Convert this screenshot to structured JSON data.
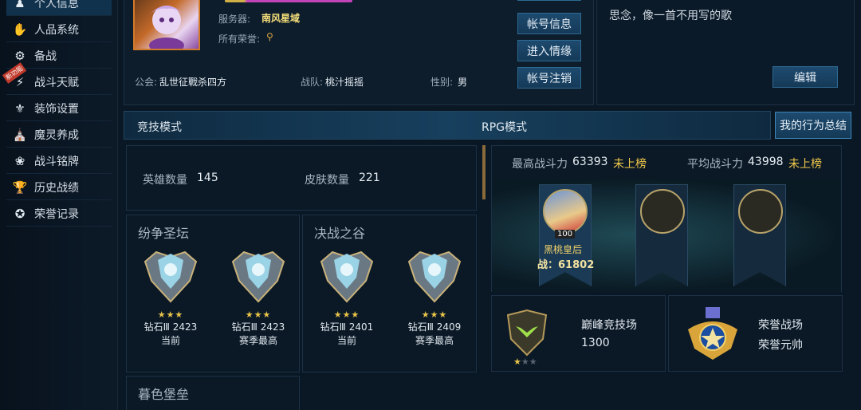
{
  "sidebar": {
    "items": [
      {
        "label": "个人信息",
        "icon": "person-icon"
      },
      {
        "label": "人品系统",
        "icon": "hand-icon"
      },
      {
        "label": "备战",
        "icon": "globe-icon"
      },
      {
        "label": "战斗天赋",
        "icon": "lightning-icon",
        "tag": "新功能"
      },
      {
        "label": "装饰设置",
        "icon": "trophy-icon"
      },
      {
        "label": "魔灵养成",
        "icon": "building-icon"
      },
      {
        "label": "战斗铭牌",
        "icon": "emblem-icon"
      },
      {
        "label": "历史战绩",
        "icon": "cup-icon"
      },
      {
        "label": "荣誉记录",
        "icon": "medal-icon"
      }
    ]
  },
  "profile": {
    "server_label": "服务器:",
    "server_value": "南风星域",
    "honor_label": "所有荣誉:",
    "guild_label": "公会:",
    "guild_value": "乱世征戰杀四方",
    "team_label": "战队:",
    "team_value": "桃汁摇摇",
    "gender_label": "性别:",
    "gender_value": "男"
  },
  "actions": {
    "account_info": "帐号信息",
    "enter_mood": "进入情缘",
    "account_cancel": "帐号注销"
  },
  "signature": {
    "text": "思念，像一首不用写的歌",
    "edit_label": "编辑"
  },
  "tabs": {
    "competitive": "竞技模式",
    "rpg": "RPG模式",
    "behavior_summary": "我的行为总结"
  },
  "counts": {
    "hero_label": "英雄数量",
    "hero_value": "145",
    "skin_label": "皮肤数量",
    "skin_value": "221"
  },
  "arenas": [
    {
      "title": "纷争圣坛",
      "ranks": [
        {
          "tier": "钻石Ⅲ",
          "score": "2423",
          "note": "当前"
        },
        {
          "tier": "钻石Ⅲ",
          "score": "2423",
          "note": "赛季最高"
        }
      ]
    },
    {
      "title": "决战之谷",
      "ranks": [
        {
          "tier": "钻石Ⅲ",
          "score": "2401",
          "note": "当前"
        },
        {
          "tier": "钻石Ⅲ",
          "score": "2409",
          "note": "赛季最高"
        }
      ]
    }
  ],
  "dusk": {
    "title": "暮色堡垒"
  },
  "power": {
    "max_label": "最高战斗力",
    "max_value": "63393",
    "max_rank": "未上榜",
    "avg_label": "平均战斗力",
    "avg_value": "43998",
    "avg_rank": "未上榜"
  },
  "top_hero": {
    "name": "黑桃皇后",
    "level": "100",
    "power_label": "战：",
    "power_value": "61802"
  },
  "peak": {
    "title": "巅峰竞技场",
    "score": "1300",
    "stars_filled": 1,
    "stars_total": 3
  },
  "honor": {
    "title": "荣誉战场",
    "rank": "荣誉元帅"
  },
  "colors": {
    "accent": "#f3c94a",
    "button": "#1d4a6e",
    "name_pink": "#e34bd1"
  }
}
